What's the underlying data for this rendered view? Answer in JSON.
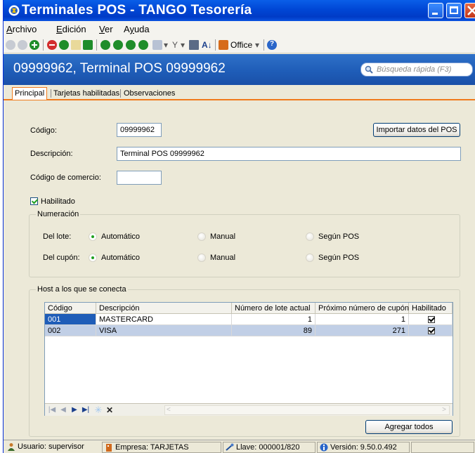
{
  "window": {
    "title": "Terminales POS - TANGO Tesorería"
  },
  "menu": [
    {
      "label": "Archivo",
      "accel_char": "A"
    },
    {
      "label": "Edición",
      "accel_char": "E"
    },
    {
      "label": "Ver",
      "accel_char": "V"
    },
    {
      "label": "Ayuda",
      "accel_char": "y"
    }
  ],
  "toolbar": {
    "office_label": "Office",
    "icons": [
      "ok-icon",
      "cancel-icon",
      "add-icon",
      "delete-icon",
      "copy-icon",
      "notes-icon",
      "refresh-icon",
      "first-icon",
      "prev-icon",
      "next-icon",
      "last-icon",
      "view-icon",
      "filter-icon",
      "columns-icon",
      "sort-icon",
      "office-icon",
      "help-icon"
    ]
  },
  "header": {
    "record_title": "09999962, Terminal POS 09999962",
    "search_placeholder": "Búsqueda rápida (F3)"
  },
  "tabs": [
    {
      "label": "Principal",
      "active": true
    },
    {
      "label": "Tarjetas habilitadas",
      "active": false
    },
    {
      "label": "Observaciones",
      "active": false
    }
  ],
  "form": {
    "codigo_label": "Código:",
    "codigo_value": "09999962",
    "importar_button": "Importar datos del POS",
    "descripcion_label": "Descripción:",
    "descripcion_value": "Terminal POS 09999962",
    "codigo_comercio_label": "Código de comercio:",
    "codigo_comercio_value": "",
    "habilitado_label": "Habilitado",
    "habilitado_checked": true
  },
  "numeracion": {
    "title": "Numeración",
    "rows": [
      {
        "label": "Del lote:",
        "selected": "Automático",
        "options": [
          "Automático",
          "Manual",
          "Según POS"
        ]
      },
      {
        "label": "Del cupón:",
        "selected": "Automático",
        "options": [
          "Automático",
          "Manual",
          "Según POS"
        ]
      }
    ]
  },
  "host": {
    "title": "Host a los que se conecta",
    "columns": [
      "Código",
      "Descripción",
      "Número de lote actual",
      "Próximo número de cupón",
      "Habilitado"
    ],
    "rows": [
      {
        "codigo": "001",
        "descripcion": "MASTERCARD",
        "lote": "1",
        "cupon": "1",
        "habilitado": true
      },
      {
        "codigo": "002",
        "descripcion": "VISA",
        "lote": "89",
        "cupon": "271",
        "habilitado": true
      }
    ],
    "agregar_button": "Agregar todos"
  },
  "status": {
    "usuario": "Usuario: supervisor",
    "empresa": "Empresa: TARJETAS",
    "llave": "Llave: 000001/820",
    "version": "Versión: 9.50.0.492"
  },
  "colors": {
    "titlebar": "#0046d5",
    "header": "#1f5db8",
    "tab_accent": "#f07a1c",
    "selected_row": "#c1cfe6"
  }
}
